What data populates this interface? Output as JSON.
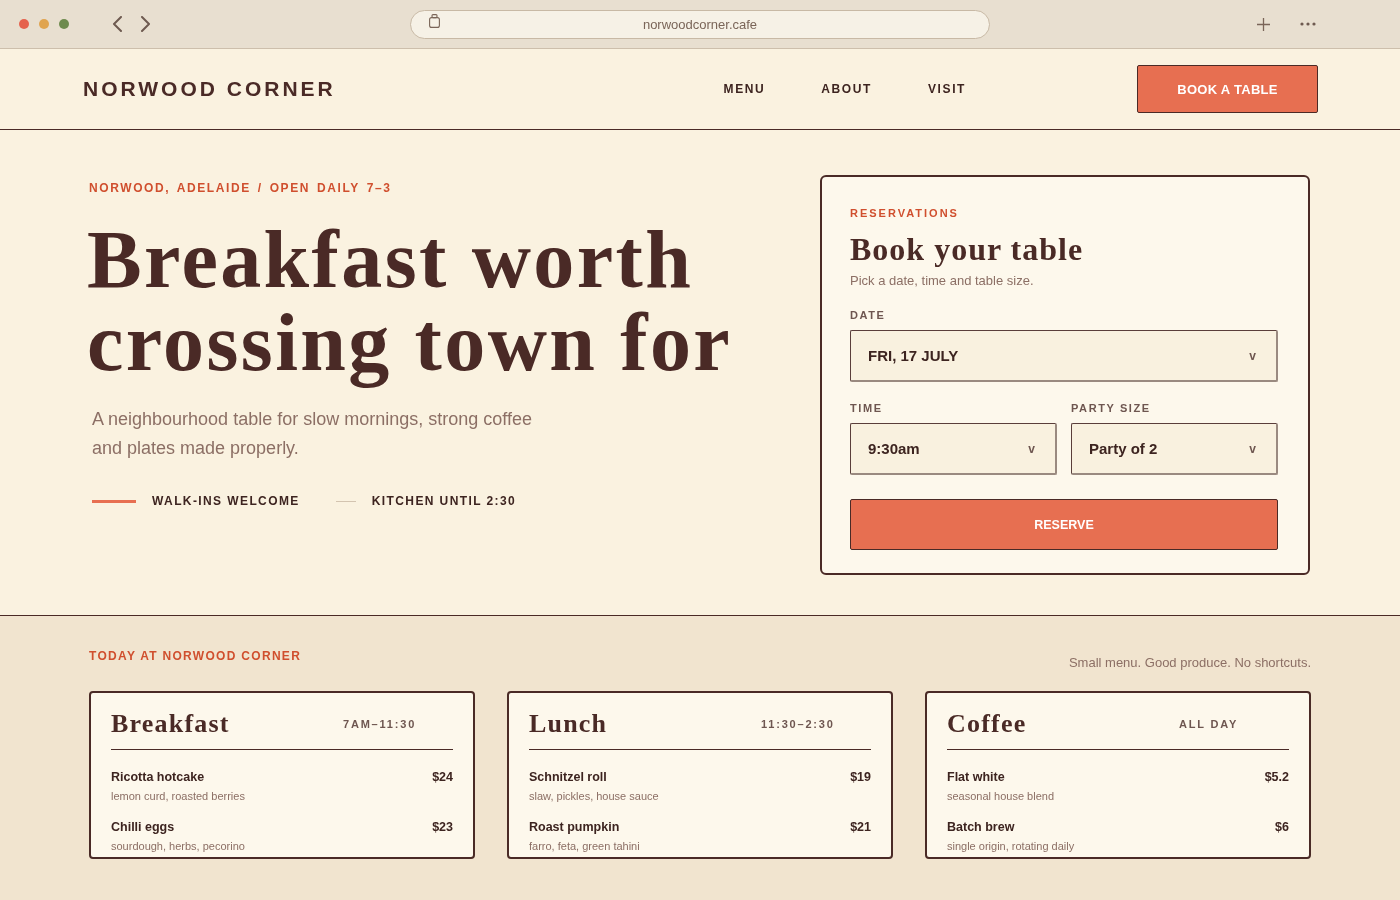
{
  "browser": {
    "url": "norwoodcorner.cafe"
  },
  "header": {
    "logo": "NORWOOD CORNER",
    "nav": [
      {
        "label": "MENU"
      },
      {
        "label": "ABOUT"
      },
      {
        "label": "VISIT"
      }
    ],
    "cta": "BOOK A TABLE"
  },
  "hero": {
    "eyebrow": "NORWOOD, ADELAIDE / OPEN DAILY 7–3",
    "title": "Breakfast worth crossing town for",
    "lede": "A neighbourhood table for slow mornings, strong coffee and plates made properly.",
    "notes": [
      {
        "label": "WALK-INS WELCOME",
        "highlighted": true
      },
      {
        "label": "KITCHEN UNTIL 2:30",
        "highlighted": false
      }
    ]
  },
  "reservation": {
    "eyebrow": "RESERVATIONS",
    "title": "Book your table",
    "subtitle": "Pick a date, time and table size.",
    "rows": [
      {
        "fields": [
          {
            "label": "DATE",
            "value": "FRI, 17 JULY",
            "caret": "v"
          }
        ]
      },
      {
        "fields": [
          {
            "label": "TIME",
            "value": "9:30am",
            "caret": "v"
          },
          {
            "label": "PARTY SIZE",
            "value": "Party of 2",
            "caret": "v"
          }
        ]
      }
    ],
    "submit": "RESERVE"
  },
  "menu": {
    "eyebrow": "TODAY AT NORWOOD CORNER",
    "tagline": "Small menu. Good produce. No shortcuts.",
    "cards": [
      {
        "title": "Breakfast",
        "hours": "7AM–11:30",
        "items": [
          {
            "name": "Ricotta hotcake",
            "price": "$24",
            "description": "lemon curd, roasted berries"
          },
          {
            "name": "Chilli eggs",
            "price": "$23",
            "description": "sourdough, herbs, pecorino"
          }
        ]
      },
      {
        "title": "Lunch",
        "hours": "11:30–2:30",
        "items": [
          {
            "name": "Schnitzel roll",
            "price": "$19",
            "description": "slaw, pickles, house sauce"
          },
          {
            "name": "Roast pumpkin",
            "price": "$21",
            "description": "farro, feta, green tahini"
          }
        ]
      },
      {
        "title": "Coffee",
        "hours": "ALL DAY",
        "items": [
          {
            "name": "Flat white",
            "price": "$5.2",
            "description": "seasonal house blend"
          },
          {
            "name": "Batch brew",
            "price": "$6",
            "description": "single origin, rotating daily"
          }
        ]
      }
    ]
  }
}
